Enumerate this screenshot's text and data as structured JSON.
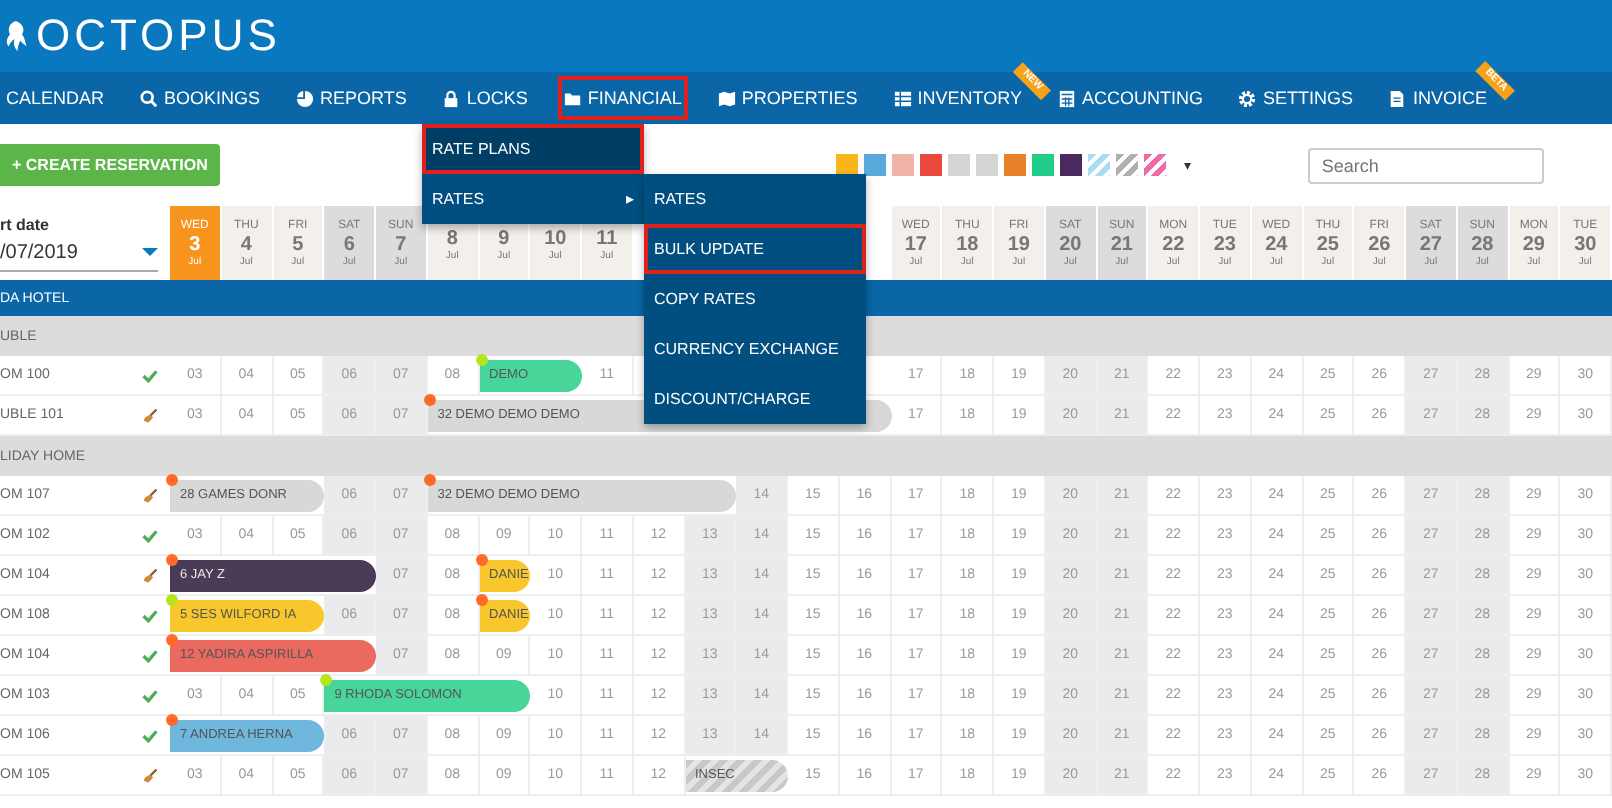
{
  "brand": {
    "name": "OCTOPUS"
  },
  "nav": [
    {
      "label": "CALENDAR",
      "kind": "plain",
      "highlighted": false
    },
    {
      "label": "BOOKINGS",
      "kind": "search",
      "highlighted": false
    },
    {
      "label": "REPORTS",
      "kind": "pie",
      "highlighted": false
    },
    {
      "label": "LOCKS",
      "kind": "lock",
      "highlighted": false
    },
    {
      "label": "FINANCIAL",
      "kind": "folder",
      "highlighted": true
    },
    {
      "label": "PROPERTIES",
      "kind": "map",
      "highlighted": false
    },
    {
      "label": "INVENTORY",
      "kind": "list",
      "highlighted": false,
      "ribbon": "NEW"
    },
    {
      "label": "ACCOUNTING",
      "kind": "calc",
      "highlighted": false
    },
    {
      "label": "SETTINGS",
      "kind": "gear",
      "highlighted": false
    },
    {
      "label": "INVOICE",
      "kind": "doc",
      "highlighted": false,
      "ribbon": "BETA"
    }
  ],
  "menu": [
    {
      "label": "RATE PLANS",
      "highlighted": true,
      "submenu": false
    },
    {
      "label": "RATES",
      "highlighted": false,
      "submenu": true,
      "arrow": "▸"
    }
  ],
  "submenu": [
    {
      "label": "RATES",
      "highlighted": false
    },
    {
      "label": "BULK UPDATE",
      "highlighted": true
    },
    {
      "label": "COPY RATES",
      "highlighted": false
    },
    {
      "label": "CURRENCY EXCHANGE",
      "highlighted": false
    },
    {
      "label": "DISCOUNT/CHARGE",
      "highlighted": false
    }
  ],
  "create_button": "+ CREATE RESERVATION",
  "swatches": [
    {
      "color": "#f9b51a",
      "kind": "solid"
    },
    {
      "color": "#5aa9dc",
      "kind": "solid"
    },
    {
      "color": "#f0b3a8",
      "kind": "solid"
    },
    {
      "color": "#e8493b",
      "kind": "solid"
    },
    {
      "color": "#d4d4d4",
      "kind": "solid"
    },
    {
      "color": "#d4d4d4",
      "kind": "solid"
    },
    {
      "color": "#e8822a",
      "kind": "solid"
    },
    {
      "color": "#22cc8a",
      "kind": "solid"
    },
    {
      "color": "#4a2a5c",
      "kind": "solid"
    },
    {
      "color": "#a8dcf0",
      "kind": "striped"
    },
    {
      "color": "#b0b0b0",
      "kind": "striped"
    },
    {
      "color": "#f06aa8",
      "kind": "striped"
    }
  ],
  "swatch_caret": "▾",
  "search": {
    "placeholder": "Search"
  },
  "start_date": {
    "label": "rt date",
    "value": "/07/2019"
  },
  "days": [
    {
      "dow": "WED",
      "day": "3",
      "month": "Jul",
      "weekend": false,
      "selected": true
    },
    {
      "dow": "THU",
      "day": "4",
      "month": "Jul",
      "weekend": false,
      "selected": false
    },
    {
      "dow": "FRI",
      "day": "5",
      "month": "Jul",
      "weekend": false,
      "selected": false
    },
    {
      "dow": "SAT",
      "day": "6",
      "month": "Jul",
      "weekend": true,
      "selected": false
    },
    {
      "dow": "SUN",
      "day": "7",
      "month": "Jul",
      "weekend": true,
      "selected": false
    },
    {
      "day": "8",
      "month": "Jul",
      "weekend": false,
      "selected": false
    },
    {
      "day": "9",
      "month": "Jul",
      "weekend": false,
      "selected": false
    },
    {
      "day": "10",
      "month": "Jul",
      "weekend": false,
      "selected": false
    },
    {
      "day": "11",
      "month": "Jul",
      "weekend": false,
      "selected": false
    },
    {
      "weekend": false
    },
    {
      "weekend": true
    },
    {
      "weekend": true
    },
    {
      "weekend": false
    },
    {
      "weekend": false
    },
    {
      "dow": "WED",
      "day": "17",
      "month": "Jul",
      "weekend": false,
      "selected": false
    },
    {
      "dow": "THU",
      "day": "18",
      "month": "Jul",
      "weekend": false,
      "selected": false
    },
    {
      "dow": "FRI",
      "day": "19",
      "month": "Jul",
      "weekend": false,
      "selected": false
    },
    {
      "dow": "SAT",
      "day": "20",
      "month": "Jul",
      "weekend": true,
      "selected": false
    },
    {
      "dow": "SUN",
      "day": "21",
      "month": "Jul",
      "weekend": true,
      "selected": false
    },
    {
      "dow": "MON",
      "day": "22",
      "month": "Jul",
      "weekend": false,
      "selected": false
    },
    {
      "dow": "TUE",
      "day": "23",
      "month": "Jul",
      "weekend": false,
      "selected": false
    },
    {
      "dow": "WED",
      "day": "24",
      "month": "Jul",
      "weekend": false,
      "selected": false
    },
    {
      "dow": "THU",
      "day": "25",
      "month": "Jul",
      "weekend": false,
      "selected": false
    },
    {
      "dow": "FRI",
      "day": "26",
      "month": "Jul",
      "weekend": false,
      "selected": false
    },
    {
      "dow": "SAT",
      "day": "27",
      "month": "Jul",
      "weekend": true,
      "selected": false
    },
    {
      "dow": "SUN",
      "day": "28",
      "month": "Jul",
      "weekend": true,
      "selected": false
    },
    {
      "dow": "MON",
      "day": "29",
      "month": "Jul",
      "weekend": false,
      "selected": false
    },
    {
      "dow": "TUE",
      "day": "30",
      "month": "Jul",
      "weekend": false,
      "selected": false
    }
  ],
  "hotel": "DA HOTEL",
  "rows": [
    {
      "kind": "group",
      "label": "UBLE"
    },
    {
      "kind": "room",
      "label": "OM 100",
      "clean": true,
      "cells": [
        "03",
        "04",
        "05",
        "06",
        "07",
        "08",
        {
          "label": "DEMO",
          "color": "#47d59a",
          "confirmed": true,
          "kind": "solid"
        },
        null,
        "11",
        null,
        null,
        null,
        null,
        null,
        "17",
        "18",
        "19",
        "20",
        "21",
        "22",
        "23",
        "24",
        "25",
        "26",
        "27",
        "28",
        "29",
        "30"
      ]
    },
    {
      "kind": "room",
      "label": "UBLE 101",
      "clean": false,
      "cells": [
        "03",
        "04",
        "05",
        "06",
        "07",
        {
          "label": "32 DEMO DEMO DEMO",
          "color": "#d8d8d8",
          "confirmed": false,
          "kind": "solid"
        },
        null,
        null,
        null,
        null,
        null,
        null,
        null,
        null,
        "17",
        "18",
        "19",
        "20",
        "21",
        "22",
        "23",
        "24",
        "25",
        "26",
        "27",
        "28",
        "29",
        "30"
      ]
    },
    {
      "kind": "group",
      "label": "LIDAY HOME"
    },
    {
      "kind": "room",
      "label": "OM 107",
      "clean": false,
      "cells": [
        {
          "label": "28 GAMES DONR",
          "color": "#d8d8d8",
          "confirmed": false,
          "kind": "solid"
        },
        null,
        null,
        "06",
        "07",
        {
          "label": "32 DEMO DEMO DEMO",
          "color": "#d8d8d8",
          "confirmed": false,
          "kind": "solid"
        },
        null,
        null,
        null,
        null,
        null,
        "14",
        "15",
        "16",
        "17",
        "18",
        "19",
        "20",
        "21",
        "22",
        "23",
        "24",
        "25",
        "26",
        "27",
        "28",
        "29",
        "30"
      ]
    },
    {
      "kind": "room",
      "label": "OM 102",
      "clean": true,
      "cells": [
        "03",
        "04",
        "05",
        "06",
        "07",
        "08",
        "09",
        "10",
        "11",
        "12",
        "13",
        "14",
        "15",
        "16",
        "17",
        "18",
        "19",
        "20",
        "21",
        "22",
        "23",
        "24",
        "25",
        "26",
        "27",
        "28",
        "29",
        "30"
      ]
    },
    {
      "kind": "room",
      "label": "OM 104",
      "clean": false,
      "cells": [
        {
          "label": "6 JAY Z",
          "color": "#4a3b56",
          "confirmed": false,
          "kind": "solid"
        },
        null,
        null,
        null,
        "07",
        "08",
        {
          "label": "DANIE",
          "color": "#f9c72b",
          "confirmed": false,
          "kind": "solid"
        },
        "10",
        "11",
        "12",
        "13",
        "14",
        "15",
        "16",
        "17",
        "18",
        "19",
        "20",
        "21",
        "22",
        "23",
        "24",
        "25",
        "26",
        "27",
        "28",
        "29",
        "30"
      ]
    },
    {
      "kind": "room",
      "label": "OM 108",
      "clean": true,
      "cells": [
        {
          "label": "5 SES WILFORD IA",
          "color": "#f9c72b",
          "confirmed": true,
          "kind": "solid"
        },
        null,
        null,
        "06",
        "07",
        "08",
        {
          "label": "DANIE",
          "color": "#f9c72b",
          "confirmed": false,
          "kind": "solid"
        },
        "10",
        "11",
        "12",
        "13",
        "14",
        "15",
        "16",
        "17",
        "18",
        "19",
        "20",
        "21",
        "22",
        "23",
        "24",
        "25",
        "26",
        "27",
        "28",
        "29",
        "30"
      ]
    },
    {
      "kind": "room",
      "label": "OM 104",
      "clean": true,
      "cells": [
        {
          "label": "12 YADIRA ASPIRILLA",
          "color": "#ea6a60",
          "confirmed": false,
          "kind": "solid"
        },
        null,
        null,
        null,
        "07",
        "08",
        "09",
        "10",
        "11",
        "12",
        "13",
        "14",
        "15",
        "16",
        "17",
        "18",
        "19",
        "20",
        "21",
        "22",
        "23",
        "24",
        "25",
        "26",
        "27",
        "28",
        "29",
        "30"
      ]
    },
    {
      "kind": "room",
      "label": "OM 103",
      "clean": true,
      "cells": [
        "03",
        "04",
        "05",
        {
          "label": "9 RHODA SOLOMON",
          "color": "#47d59a",
          "confirmed": true,
          "kind": "solid"
        },
        null,
        null,
        null,
        "10",
        "11",
        "12",
        "13",
        "14",
        "15",
        "16",
        "17",
        "18",
        "19",
        "20",
        "21",
        "22",
        "23",
        "24",
        "25",
        "26",
        "27",
        "28",
        "29",
        "30"
      ]
    },
    {
      "kind": "room",
      "label": "OM 106",
      "clean": true,
      "cells": [
        {
          "label": "7 ANDREA HERNA",
          "color": "#6fb7dd",
          "confirmed": false,
          "kind": "solid"
        },
        null,
        null,
        "06",
        "07",
        "08",
        "09",
        "10",
        "11",
        "12",
        "13",
        "14",
        "15",
        "16",
        "17",
        "18",
        "19",
        "20",
        "21",
        "22",
        "23",
        "24",
        "25",
        "26",
        "27",
        "28",
        "29",
        "30"
      ]
    },
    {
      "kind": "room",
      "label": "OM 105",
      "clean": false,
      "cells": [
        "03",
        "04",
        "05",
        "06",
        "07",
        "08",
        "09",
        "10",
        "11",
        "12",
        {
          "label": "INSEC",
          "color": "#c8c8c8",
          "kind": "striped"
        },
        null,
        "15",
        "16",
        "17",
        "18",
        "19",
        "20",
        "21",
        "22",
        "23",
        "24",
        "25",
        "26",
        "27",
        "28",
        "29",
        "30"
      ]
    }
  ]
}
